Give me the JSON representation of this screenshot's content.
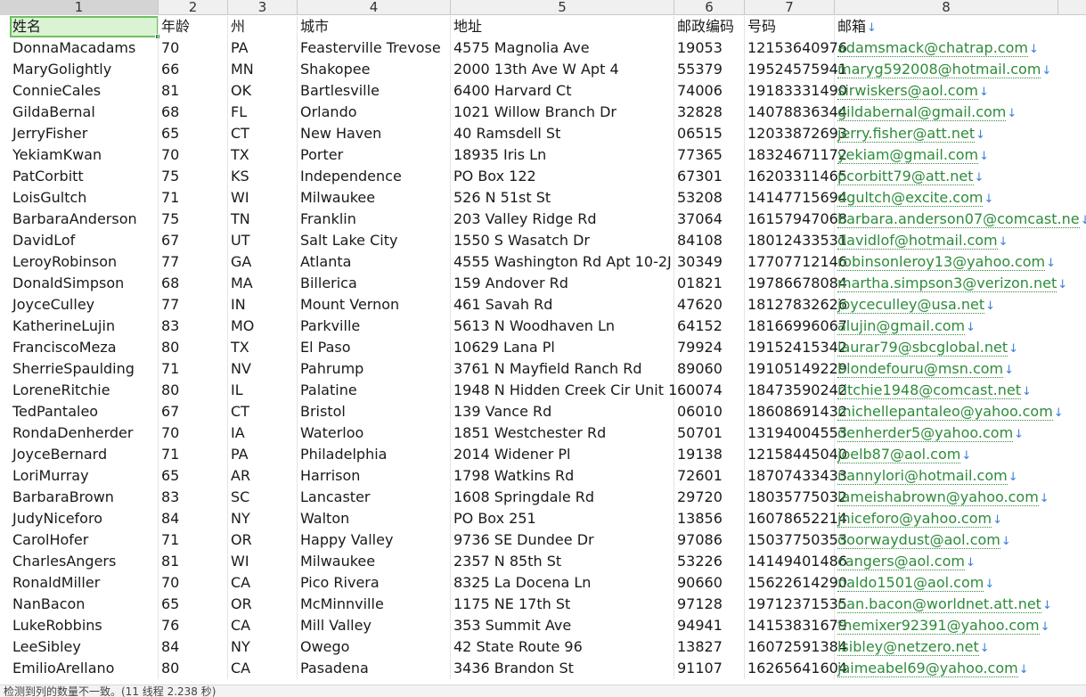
{
  "column_numbers": [
    "1",
    "2",
    "3",
    "4",
    "5",
    "6",
    "7",
    "8"
  ],
  "header": [
    "姓名",
    "年龄",
    "州",
    "城市",
    "地址",
    "邮政编码",
    "号码",
    "邮箱"
  ],
  "rows": [
    [
      "DonnaMacadams",
      "70",
      "PA",
      "Feasterville Trevose",
      "4575 Magnolia Ave",
      "19053",
      "12153640976",
      "adamsmack@chatrap.com"
    ],
    [
      "MaryGolightly",
      "66",
      "MN",
      "Shakopee",
      "2000 13th Ave W Apt 4",
      "55379",
      "19524575941",
      "maryg592008@hotmail.com"
    ],
    [
      "ConnieCales",
      "81",
      "OK",
      "Bartlesville",
      "6400 Harvard Ct",
      "74006",
      "19183331490",
      "sirwiskers@aol.com"
    ],
    [
      "GildaBernal",
      "68",
      "FL",
      "Orlando",
      "1021 Willow Branch Dr",
      "32828",
      "14078836344",
      "gildabernal@gmail.com"
    ],
    [
      "JerryFisher",
      "65",
      "CT",
      "New Haven",
      "40 Ramsdell St",
      "06515",
      "12033872693",
      "jerry.fisher@att.net"
    ],
    [
      "YekiamKwan",
      "70",
      "TX",
      "Porter",
      "18935 Iris Ln",
      "77365",
      "18324671172",
      "yekiam@gmail.com"
    ],
    [
      "PatCorbitt",
      "75",
      "KS",
      "Independence",
      "PO Box 122",
      "67301",
      "16203311465",
      "pcorbitt79@att.net"
    ],
    [
      "LoisGultch",
      "71",
      "WI",
      "Milwaukee",
      "526 N 51st St",
      "53208",
      "14147715694",
      "dgultch@excite.com"
    ],
    [
      "BarbaraAnderson",
      "75",
      "TN",
      "Franklin",
      "203 Valley Ridge Rd",
      "37064",
      "16157947068",
      "barbara.anderson07@comcast.ne"
    ],
    [
      "DavidLof",
      "67",
      "UT",
      "Salt Lake City",
      "1550 S Wasatch Dr",
      "84108",
      "18012433531",
      "davidlof@hotmail.com"
    ],
    [
      "LeroyRobinson",
      "77",
      "GA",
      "Atlanta",
      "4555 Washington Rd Apt 10-2J",
      "30349",
      "17707712146",
      "robinsonleroy13@yahoo.com"
    ],
    [
      "DonaldSimpson",
      "68",
      "MA",
      "Billerica",
      "159 Andover Rd",
      "01821",
      "19786678084",
      "martha.simpson3@verizon.net"
    ],
    [
      "JoyceCulley",
      "77",
      "IN",
      "Mount Vernon",
      "461 Savah Rd",
      "47620",
      "18127832626",
      "joyceculley@usa.net"
    ],
    [
      "KatherineLujin",
      "83",
      "MO",
      "Parkville",
      "5613 N Woodhaven Ln",
      "64152",
      "18166996067",
      "alujin@gmail.com"
    ],
    [
      "FranciscoMeza",
      "80",
      "TX",
      "El Paso",
      "10629 Lana Pl",
      "79924",
      "19152415342",
      "laurar79@sbcglobal.net"
    ],
    [
      "SherrieSpaulding",
      "71",
      "NV",
      "Pahrump",
      "3761 N Mayfield Ranch Rd",
      "89060",
      "19105149229",
      "blondefouru@msn.com"
    ],
    [
      "LoreneRitchie",
      "80",
      "IL",
      "Palatine",
      "1948 N Hidden Creek Cir Unit 1",
      "60074",
      "18473590242",
      "ritchie1948@comcast.net"
    ],
    [
      "TedPantaleo",
      "67",
      "CT",
      "Bristol",
      "139 Vance Rd",
      "06010",
      "18608691432",
      "michellepantaleo@yahoo.com"
    ],
    [
      "RondaDenherder",
      "70",
      "IA",
      "Waterloo",
      "1851 Westchester Rd",
      "50701",
      "13194004553",
      "denherder5@yahoo.com"
    ],
    [
      "JoyceBernard",
      "71",
      "PA",
      "Philadelphia",
      "2014 Widener Pl",
      "19138",
      "12158445040",
      "joelb87@aol.com"
    ],
    [
      "LoriMurray",
      "65",
      "AR",
      "Harrison",
      "1798 Watkins Rd",
      "72601",
      "18707433433",
      "nannylori@hotmail.com"
    ],
    [
      "BarbaraBrown",
      "83",
      "SC",
      "Lancaster",
      "1608 Springdale Rd",
      "29720",
      "18035775032",
      "lameishabrown@yahoo.com"
    ],
    [
      "JudyNiceforo",
      "84",
      "NY",
      "Walton",
      "PO Box 251",
      "13856",
      "16078652214",
      "jniceforo@yahoo.com"
    ],
    [
      "CarolHofer",
      "71",
      "OR",
      "Happy Valley",
      "9736 SE Dundee Dr",
      "97086",
      "15037750353",
      "doorwaydust@aol.com"
    ],
    [
      "CharlesAngers",
      "81",
      "WI",
      "Milwaukee",
      "2357 N 85th St",
      "53226",
      "14149401486",
      "cangers@aol.com"
    ],
    [
      "RonaldMiller",
      "70",
      "CA",
      "Pico Rivera",
      "8325 La Docena Ln",
      "90660",
      "15622614290",
      "naldo1501@aol.com"
    ],
    [
      "NanBacon",
      "65",
      "OR",
      "McMinnville",
      "1175 NE 17th St",
      "97128",
      "19712371535",
      "nan.bacon@worldnet.att.net"
    ],
    [
      "LukeRobbins",
      "76",
      "CA",
      "Mill Valley",
      "353 Summit Ave",
      "94941",
      "14153831679",
      "themixer92391@yahoo.com"
    ],
    [
      "LeeSibley",
      "84",
      "NY",
      "Owego",
      "42 State Route 96",
      "13827",
      "16072591384",
      "lsibley@netzero.net"
    ],
    [
      "EmilioArellano",
      "80",
      "CA",
      "Pasadena",
      "3436 Brandon St",
      "91107",
      "16265641604",
      "jaimeabel69@yahoo.com"
    ]
  ],
  "link_arrow_glyph": "↓",
  "status_text": "检测到列的数量不一致。(11 线程 2.238 秒)",
  "colors": {
    "email_link": "#2e8b3a",
    "arrow": "#3b7fd9",
    "active_cell_bg": "#d9f3d3",
    "active_cell_border": "#6fc061"
  }
}
